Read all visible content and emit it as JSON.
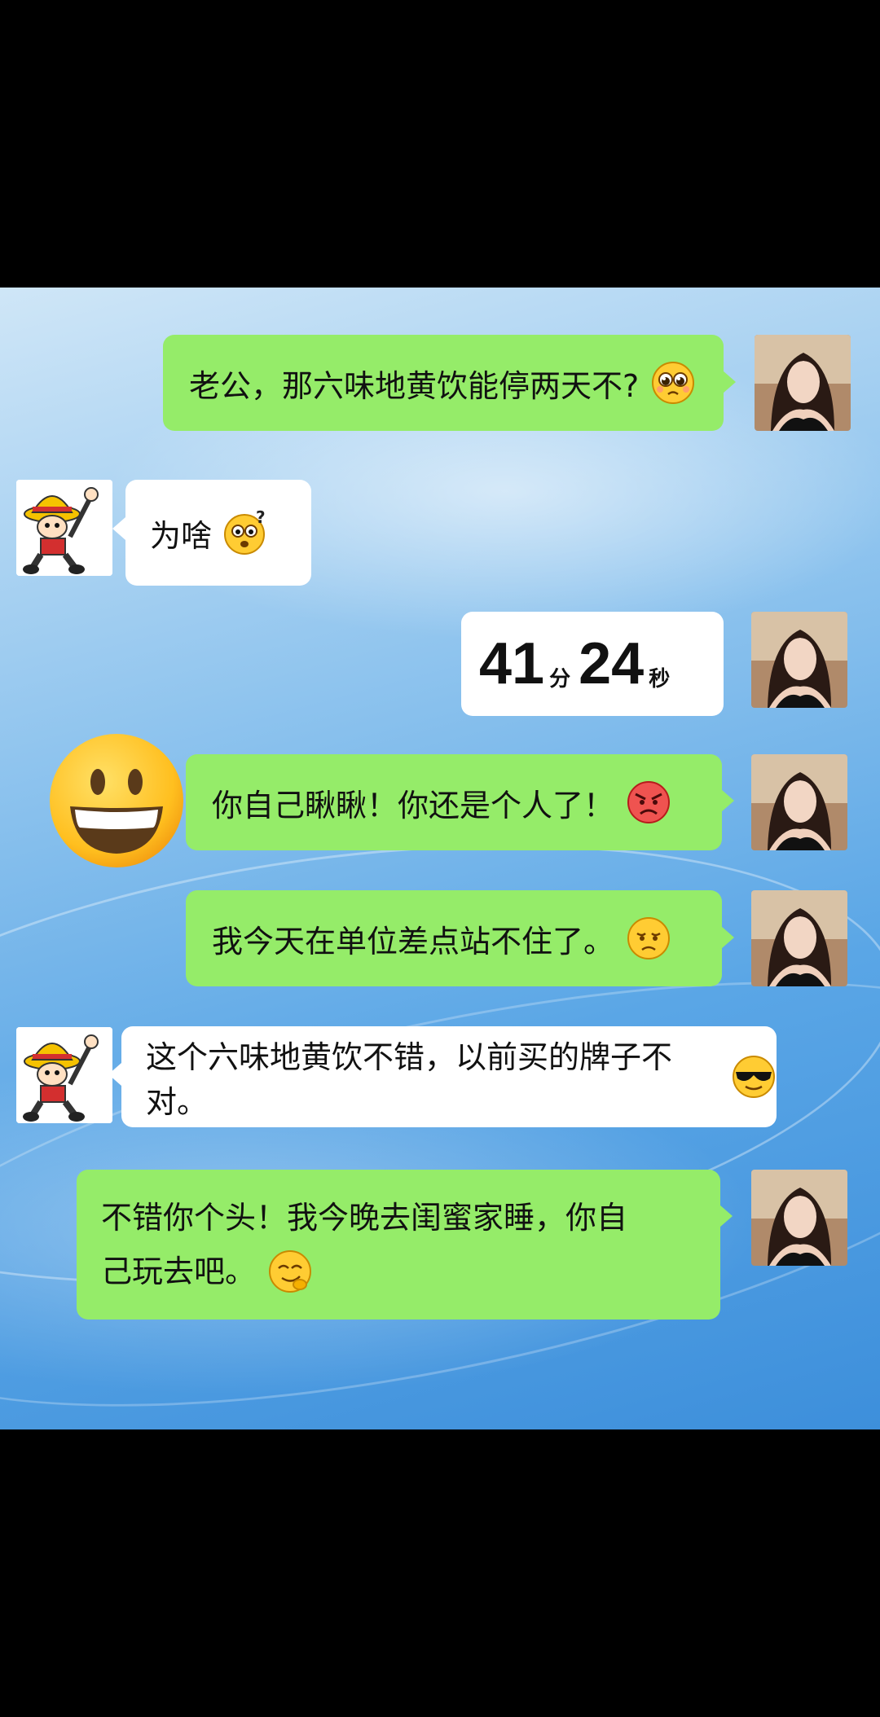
{
  "messages": [
    {
      "sender": "me",
      "text": "老公，那六味地黄饮能停两天不?",
      "emoji": "pleading-face-icon"
    },
    {
      "sender": "other",
      "text": "为啥",
      "emoji": "confused-face-icon"
    },
    {
      "sender": "me",
      "timer": {
        "minutes": "41",
        "min_unit": "分",
        "seconds": "24",
        "sec_unit": "秒"
      }
    },
    {
      "sender": "me",
      "text": "你自己瞅瞅！你还是个人了！",
      "emoji": "angry-face-icon"
    },
    {
      "sender": "me",
      "text": "我今天在单位差点站不住了。",
      "emoji": "sad-face-icon"
    },
    {
      "sender": "other",
      "text": "这个六味地黄饮不错，以前买的牌子不对。",
      "emoji": "sunglasses-face-icon"
    },
    {
      "sender": "me",
      "text_line1": " 不错你个头！我今晚去闺蜜家睡，你自",
      "text_line2": "己玩去吧。",
      "emoji": "smirk-face-icon"
    }
  ],
  "overlay_emoji": "grinning-face-icon",
  "colors": {
    "my_bubble": "#95ec69",
    "other_bubble": "#ffffff",
    "background": "#5aa6e6"
  }
}
